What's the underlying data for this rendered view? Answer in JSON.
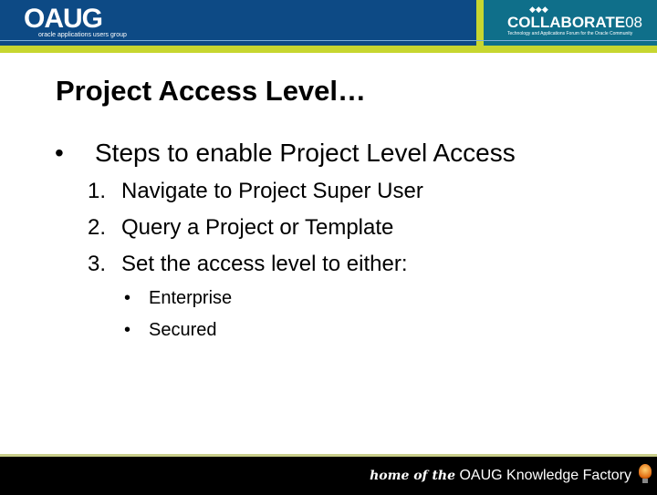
{
  "header": {
    "left_logo": "OAUG",
    "left_tagline": "oracle applications users group",
    "right_logo_word": "COLLABORATE",
    "right_logo_num": "08",
    "right_tagline": "Technology and Applications Forum for the Oracle Community",
    "brand_colors": {
      "navy": "#0d4a85",
      "teal": "#0f6f8a",
      "lime": "#c7d630"
    }
  },
  "slide": {
    "title": "Project Access Level…",
    "bullet_glyph": "•",
    "bullet": "Steps to enable Project Level Access",
    "steps": [
      {
        "num": "1.",
        "text": "Navigate to Project Super User"
      },
      {
        "num": "2.",
        "text": "Query a Project or Template"
      },
      {
        "num": "3.",
        "text": "Set the access level to either:"
      }
    ],
    "sub_bullets": [
      "Enterprise",
      "Secured"
    ]
  },
  "footer": {
    "script_text": "home of the",
    "text": "OAUG Knowledge Factory",
    "icon": "lightbulb-icon"
  }
}
